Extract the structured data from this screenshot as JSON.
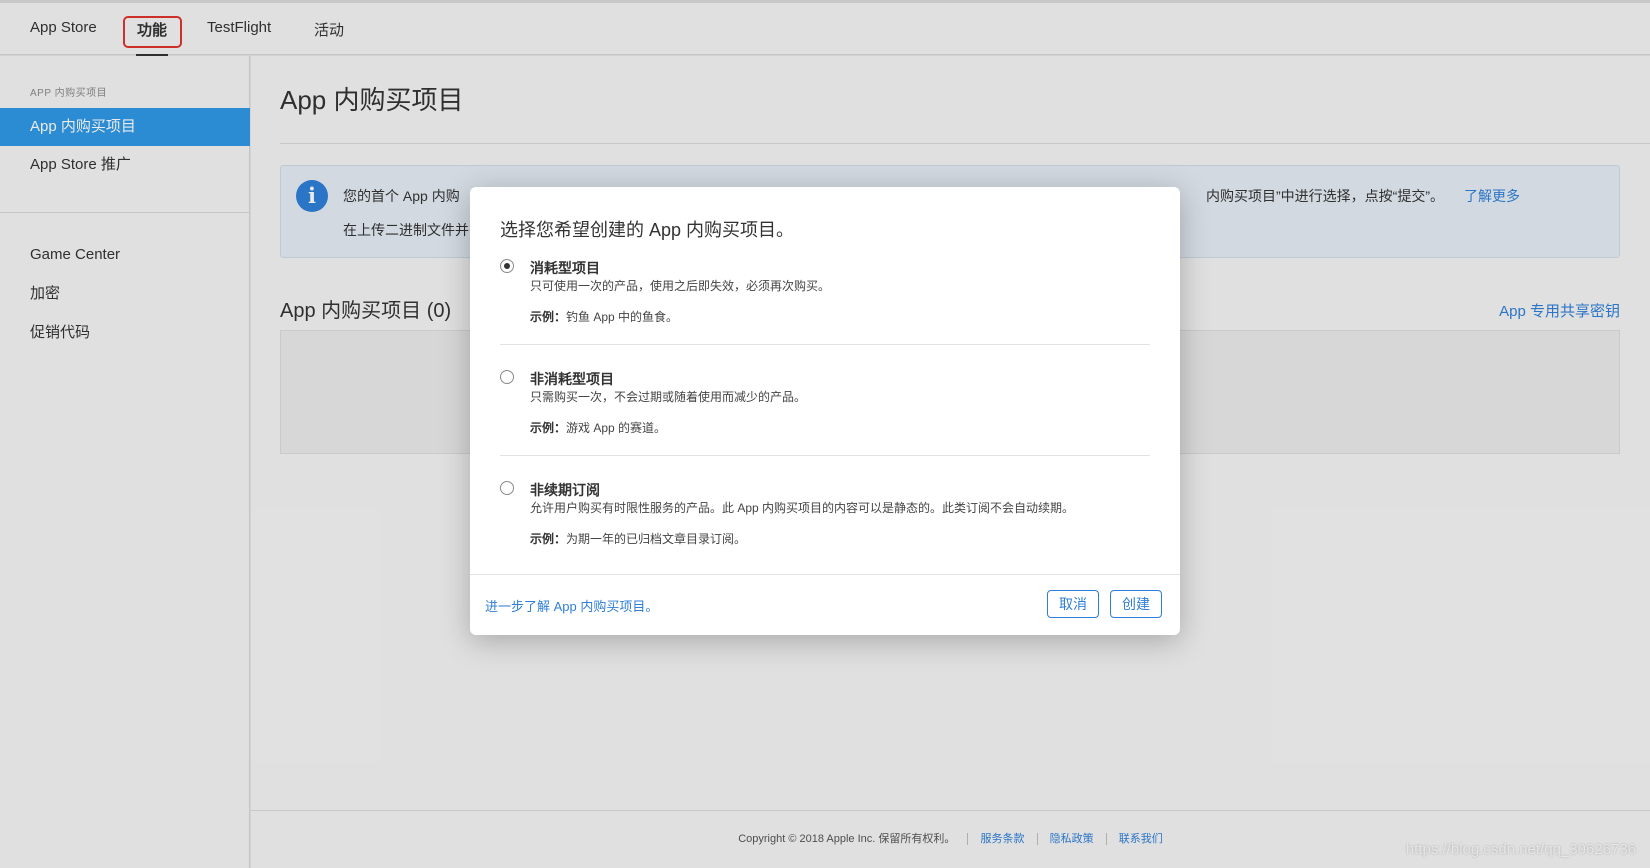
{
  "topnav": {
    "tabs": [
      {
        "label": "App Store"
      },
      {
        "label": "功能"
      },
      {
        "label": "TestFlight"
      },
      {
        "label": "活动"
      }
    ]
  },
  "sidebar": {
    "section_label": "APP 内购买项目",
    "items": [
      {
        "label": "App 内购买项目"
      },
      {
        "label": "App Store 推广"
      },
      {
        "label": "Game Center"
      },
      {
        "label": "加密"
      },
      {
        "label": "促销代码"
      }
    ]
  },
  "main": {
    "title": "App 内购买项目",
    "info": {
      "line1_start": "您的首个 App 内购",
      "line1_end": "内购买项目”中进行选择，点按“提交”。",
      "learn_more": "了解更多",
      "line2_start": "在上传二进制文件并"
    },
    "list_heading": "App 内购买项目 (0)",
    "shared_secret": "App 专用共享密钥"
  },
  "footer": {
    "copyright": "Copyright © 2018 Apple Inc. 保留所有权利。",
    "terms": "服务条款",
    "privacy": "隐私政策",
    "contact": "联系我们"
  },
  "watermark": "https://blog.csdn.net/qq_30626736",
  "modal": {
    "title": "选择您希望创建的 App 内购买项目。",
    "example_label": "示例：",
    "options": [
      {
        "title": "消耗型项目",
        "description": "只可使用一次的产品，使用之后即失效，必须再次购买。",
        "example": "钓鱼 App 中的鱼食。",
        "selected": true
      },
      {
        "title": "非消耗型项目",
        "description": "只需购买一次，不会过期或随着使用而减少的产品。",
        "example": "游戏 App 的赛道。",
        "selected": false
      },
      {
        "title": "非续期订阅",
        "description": "允许用户购买有时限性服务的产品。此 App 内购买项目的内容可以是静态的。此类订阅不会自动续期。",
        "example": "为期一年的已归档文章目录订阅。",
        "selected": false
      }
    ],
    "learn_link": "进一步了解 App 内购买项目。",
    "cancel_label": "取消",
    "create_label": "创建"
  },
  "colors": {
    "accent": "#2f7fd7",
    "sidebar_selected": "#2f97e5",
    "highlight_box": "#e0342e"
  }
}
